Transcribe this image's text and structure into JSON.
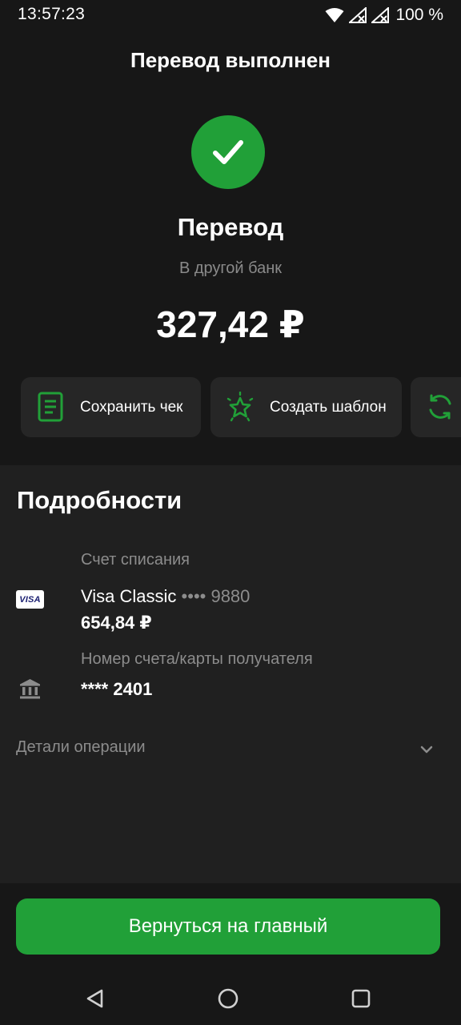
{
  "status_bar": {
    "time": "13:57:23",
    "battery": "100 %",
    "icons": [
      "wifi-icon",
      "signal-off-icon",
      "signal-off-icon"
    ]
  },
  "header": {
    "title": "Перевод выполнен"
  },
  "operation": {
    "status_icon": "check-icon",
    "title": "Перевод",
    "subtitle": "В другой банк",
    "amount": "327,42 ₽"
  },
  "actions": [
    {
      "label": "Сохранить чек",
      "icon": "receipt-icon"
    },
    {
      "label": "Создать шаблон",
      "icon": "star-icon"
    },
    {
      "label": "",
      "icon": "repeat-icon"
    }
  ],
  "details": {
    "title": "Подробности",
    "debit_account": {
      "label": "Счет списания",
      "card_name": "Visa Classic",
      "card_mask": " •••• 9880",
      "balance": "654,84 ₽",
      "badge": "VISA"
    },
    "recipient": {
      "label": "Номер счета/карты получателя",
      "value": "**** 2401",
      "icon": "bank-icon"
    },
    "operation_details_label": "Детали операции"
  },
  "footer": {
    "home_button_label": "Вернуться на главный"
  },
  "colors": {
    "accent": "#21a038",
    "background": "#171717",
    "panel": "#202020",
    "chip": "#262626",
    "muted_text": "#8c8c8c"
  }
}
